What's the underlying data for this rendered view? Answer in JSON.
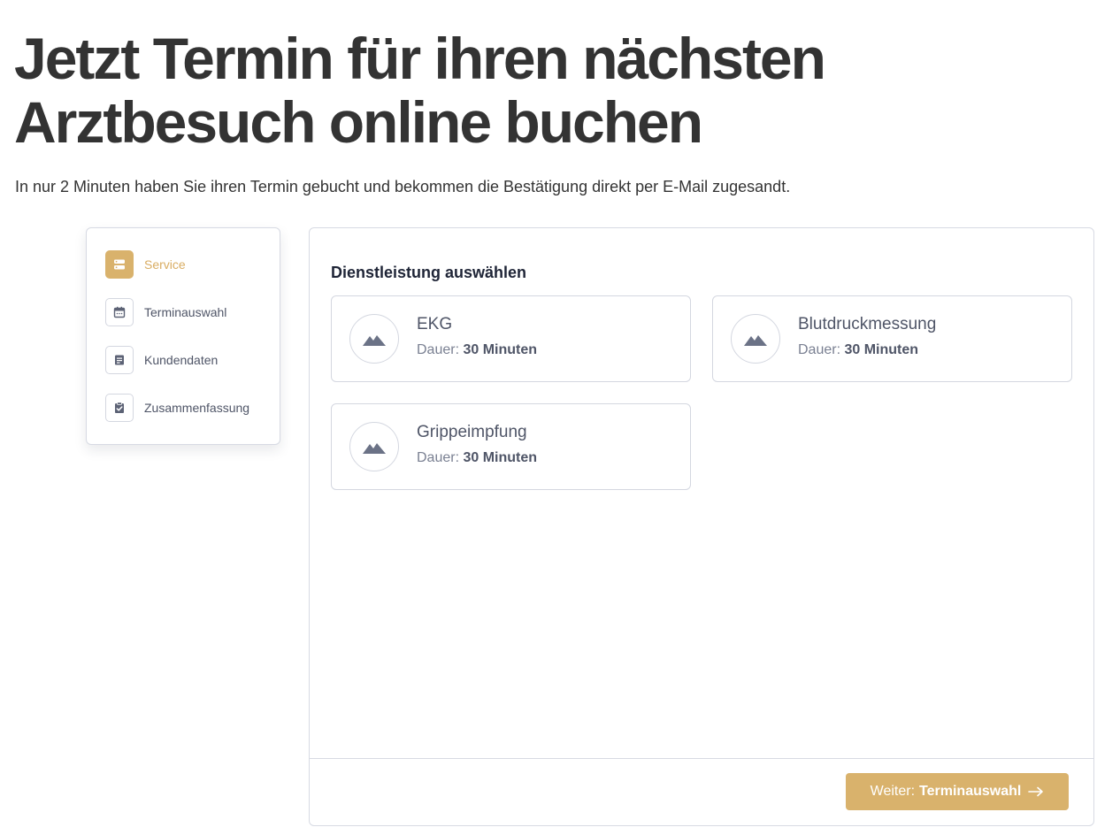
{
  "hero": {
    "title_line1": "Jetzt Termin für ihren nächsten",
    "title_line2": "Arztbesuch online buchen",
    "subtitle": "In nur 2 Minuten haben Sie ihren Termin gebucht und bekommen die Bestätigung direkt per E-Mail zugesandt."
  },
  "steps": [
    {
      "label": "Service",
      "icon": "server-icon",
      "active": true
    },
    {
      "label": "Terminauswahl",
      "icon": "calendar-icon",
      "active": false
    },
    {
      "label": "Kundendaten",
      "icon": "document-icon",
      "active": false
    },
    {
      "label": "Zusammenfassung",
      "icon": "clipboard-check-icon",
      "active": false
    }
  ],
  "panel": {
    "title": "Dienstleistung auswählen",
    "duration_prefix": "Dauer:",
    "services": [
      {
        "name": "EKG",
        "duration": "30 Minuten",
        "icon": "image-placeholder-icon"
      },
      {
        "name": "Blutdruckmessung",
        "duration": "30 Minuten",
        "icon": "image-placeholder-icon"
      },
      {
        "name": "Grippeimpfung",
        "duration": "30 Minuten",
        "icon": "image-placeholder-icon"
      }
    ],
    "next_button": {
      "prefix": "Weiter:",
      "target": "Terminauswahl",
      "icon": "arrow-right-icon"
    }
  },
  "colors": {
    "accent": "#d9b26c",
    "heading": "#333333",
    "muted_text": "#4f5567",
    "border": "#d7dae3"
  }
}
